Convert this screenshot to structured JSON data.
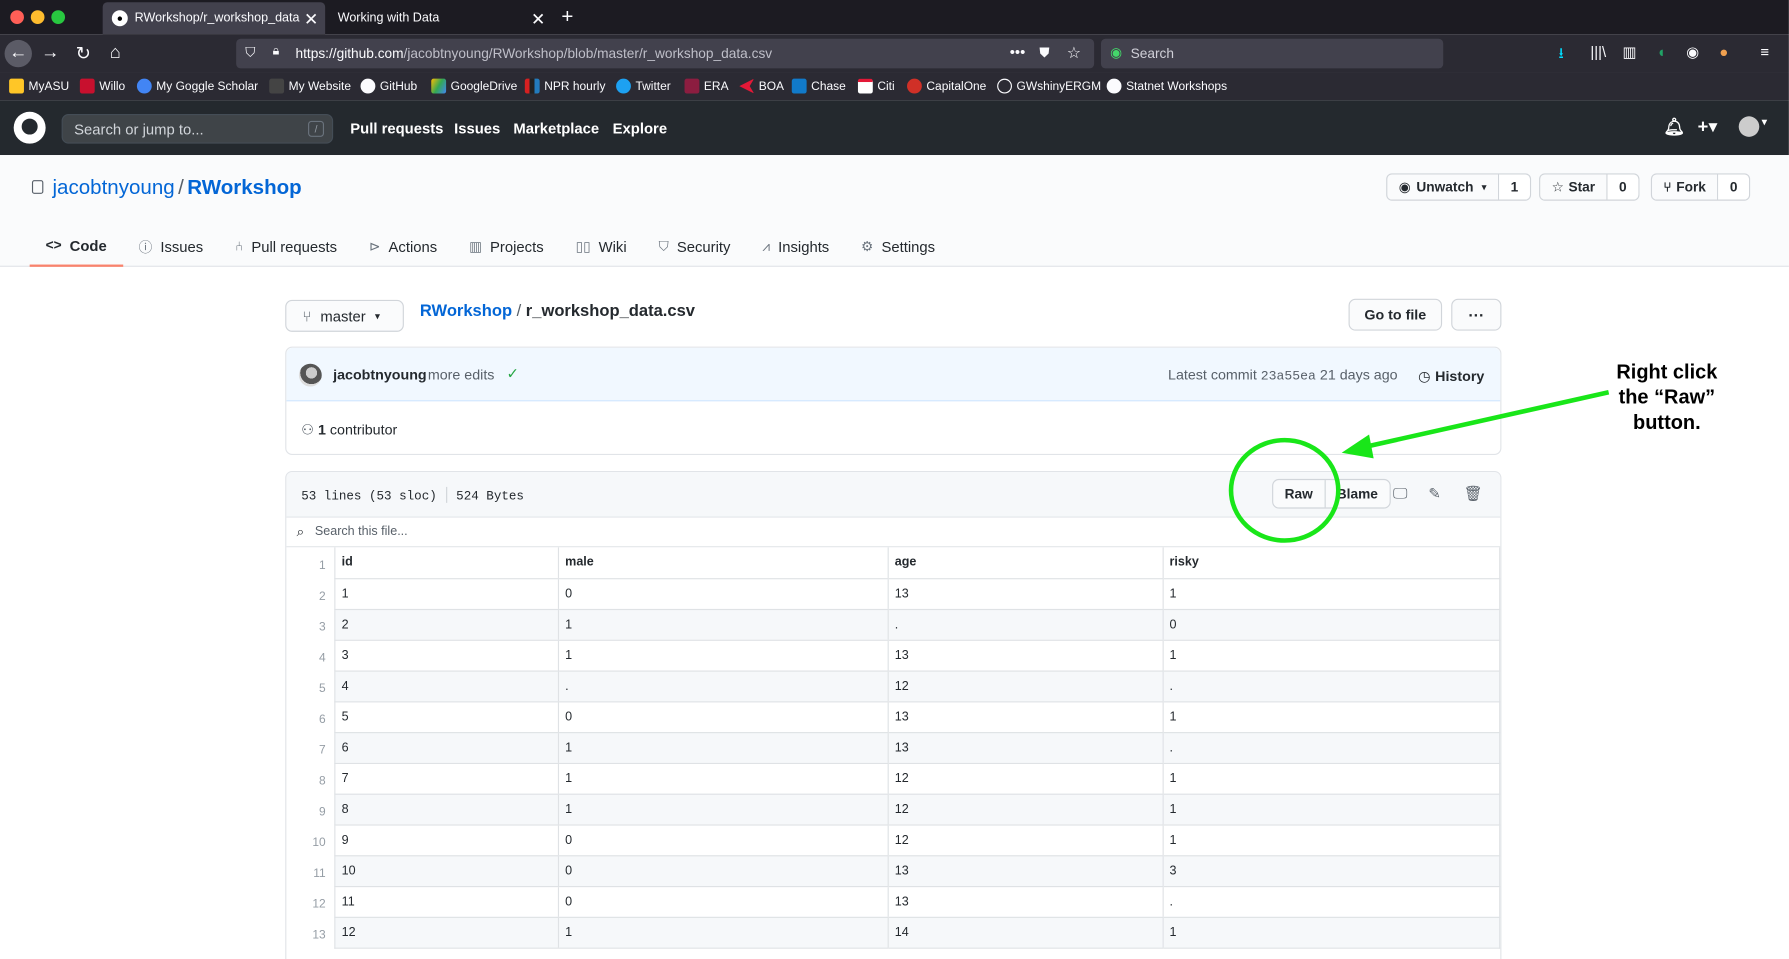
{
  "browser": {
    "tabs": [
      {
        "title": "RWorkshop/r_workshop_data.csv",
        "active": true
      },
      {
        "title": "Working with Data",
        "active": false
      }
    ],
    "url_host": "https://github.com",
    "url_path": "/jacobtnyoung/RWorkshop/blob/master/r_workshop_data.csv",
    "search_placeholder": "Search",
    "bookmarks": [
      "MyASU",
      "Willo",
      "My Goggle Scholar",
      "My Website",
      "GitHub",
      "GoogleDrive",
      "NPR hourly",
      "Twitter",
      "ERA",
      "BOA",
      "Chase",
      "Citi",
      "CapitalOne",
      "GWshinyERGM",
      "Statnet Workshops"
    ]
  },
  "github": {
    "search_placeholder": "Search or jump to...",
    "search_shortcut": "/",
    "nav": [
      "Pull requests",
      "Issues",
      "Marketplace",
      "Explore"
    ]
  },
  "repo": {
    "owner": "jacobtnyoung",
    "separator": "/",
    "name": "RWorkshop",
    "watch_label": "Unwatch",
    "watch_count": "1",
    "star_label": "Star",
    "star_count": "0",
    "fork_label": "Fork",
    "fork_count": "0",
    "tabs": [
      "Code",
      "Issues",
      "Pull requests",
      "Actions",
      "Projects",
      "Wiki",
      "Security",
      "Insights",
      "Settings"
    ]
  },
  "file": {
    "branch": "master",
    "breadcrumb_repo": "RWorkshop",
    "breadcrumb_sep": "/",
    "breadcrumb_file": "r_workshop_data.csv",
    "go_to_file": "Go to file",
    "more": "···",
    "commit_author": "jacobtnyoung",
    "commit_message": "more edits",
    "commit_check": "✓",
    "latest_commit_label": "Latest commit",
    "commit_sha": "23a55ea",
    "commit_age": "21 days ago",
    "history_label": "History",
    "contributors_count": "1",
    "contributors_label": "contributor",
    "lines_info": "53 lines (53 sloc)",
    "size_info": "524 Bytes",
    "raw_label": "Raw",
    "blame_label": "Blame",
    "search_file_placeholder": "Search this file...",
    "headers": [
      "id",
      "male",
      "age",
      "risky"
    ],
    "line_numbers": [
      "1",
      "2",
      "3",
      "4",
      "5",
      "6",
      "7",
      "8",
      "9",
      "10",
      "11",
      "12",
      "13"
    ],
    "rows": [
      [
        "1",
        "0",
        "13",
        "1"
      ],
      [
        "2",
        "1",
        ".",
        "0"
      ],
      [
        "3",
        "1",
        "13",
        "1"
      ],
      [
        "4",
        ".",
        "12",
        "."
      ],
      [
        "5",
        "0",
        "13",
        "1"
      ],
      [
        "6",
        "1",
        "13",
        "."
      ],
      [
        "7",
        "1",
        "12",
        "1"
      ],
      [
        "8",
        "1",
        "12",
        "1"
      ],
      [
        "9",
        "0",
        "12",
        "1"
      ],
      [
        "10",
        "0",
        "13",
        "3"
      ],
      [
        "11",
        "0",
        "13",
        "."
      ],
      [
        "12",
        "1",
        "14",
        "1"
      ]
    ]
  },
  "annotation": {
    "line1": "Right click",
    "line2": "the “Raw”",
    "line3": "button.",
    "color": "#19e619"
  }
}
